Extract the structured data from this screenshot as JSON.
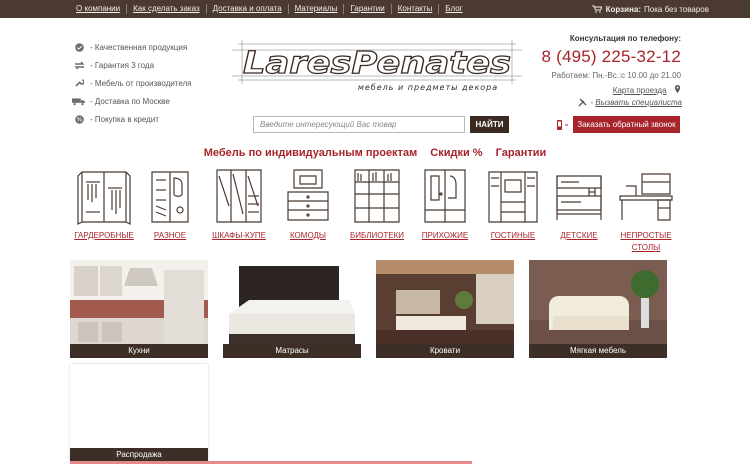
{
  "topnav": {
    "items": [
      "О компании",
      "Как сделать заказ",
      "Доставка и оплата",
      "Материалы",
      "Гарантии",
      "Контакты",
      "Блог"
    ]
  },
  "cart": {
    "label": "Корзина:",
    "status": "Пока без товаров",
    "icon": "cart-icon"
  },
  "advantages": [
    {
      "label": "- Качественная продукция",
      "icon": "check-icon"
    },
    {
      "label": "- Гарантия 3 года",
      "icon": "exchange-icon"
    },
    {
      "label": "- Мебель от производителя",
      "icon": "wrench-icon"
    },
    {
      "label": "- Доставка по Москве",
      "icon": "truck-icon"
    },
    {
      "label": "- Покупка в кредит",
      "icon": "percent-icon"
    }
  ],
  "logo": {
    "main_text": "LaresPenates",
    "tagline": "мебель и предметы декора"
  },
  "contact": {
    "consult_label": "Консультация по телефону:",
    "phone": "8 (495) 225-32-12",
    "hours": "Работаем: Пн.-Вс.:с 10.00 до 21.00",
    "route_link": "Карта проезда",
    "specialist_link": "Вызвать специалиста"
  },
  "search": {
    "placeholder": "Введите интересующий Вас товар",
    "button_label": "НАЙТИ"
  },
  "callback": {
    "button_label": "Заказать обратный звонок"
  },
  "promo": {
    "items": [
      "Мебель по индивидуальным проектам",
      "Скидки %",
      "Гарантии"
    ]
  },
  "categories": [
    {
      "label": "ГАРДЕРОБНЫЕ",
      "icon": "wardrobe-room-icon"
    },
    {
      "label": "РАЗНОЕ",
      "icon": "misc-furniture-icon"
    },
    {
      "label": "ШКАФЫ-КУПЕ",
      "icon": "sliding-wardrobe-icon"
    },
    {
      "label": "КОМОДЫ",
      "icon": "dresser-icon"
    },
    {
      "label": "БИБЛИОТЕКИ",
      "icon": "bookcase-icon"
    },
    {
      "label": "ПРИХОЖИЕ",
      "icon": "hallway-icon"
    },
    {
      "label": "ГОСТИНЫЕ",
      "icon": "living-room-wall-icon"
    },
    {
      "label": "ДЕТСКИЕ",
      "icon": "bunk-bed-icon"
    },
    {
      "label": "НЕПРОСТЫЕ СТОЛЫ",
      "icon": "desk-icon"
    }
  ],
  "products": [
    {
      "label": "Кухни",
      "image": "kitchen-photo"
    },
    {
      "label": "Матрасы",
      "image": "mattress-photo"
    },
    {
      "label": "Кровати",
      "image": "bed-photo"
    },
    {
      "label": "Мягкая мебель",
      "image": "sofa-photo"
    },
    {
      "label": "Распродажа",
      "image": "sale-photo"
    }
  ],
  "colors": {
    "brand_dark": "#4a3a32",
    "accent_red": "#a8242b",
    "caption_bg": "#3d2f28"
  }
}
